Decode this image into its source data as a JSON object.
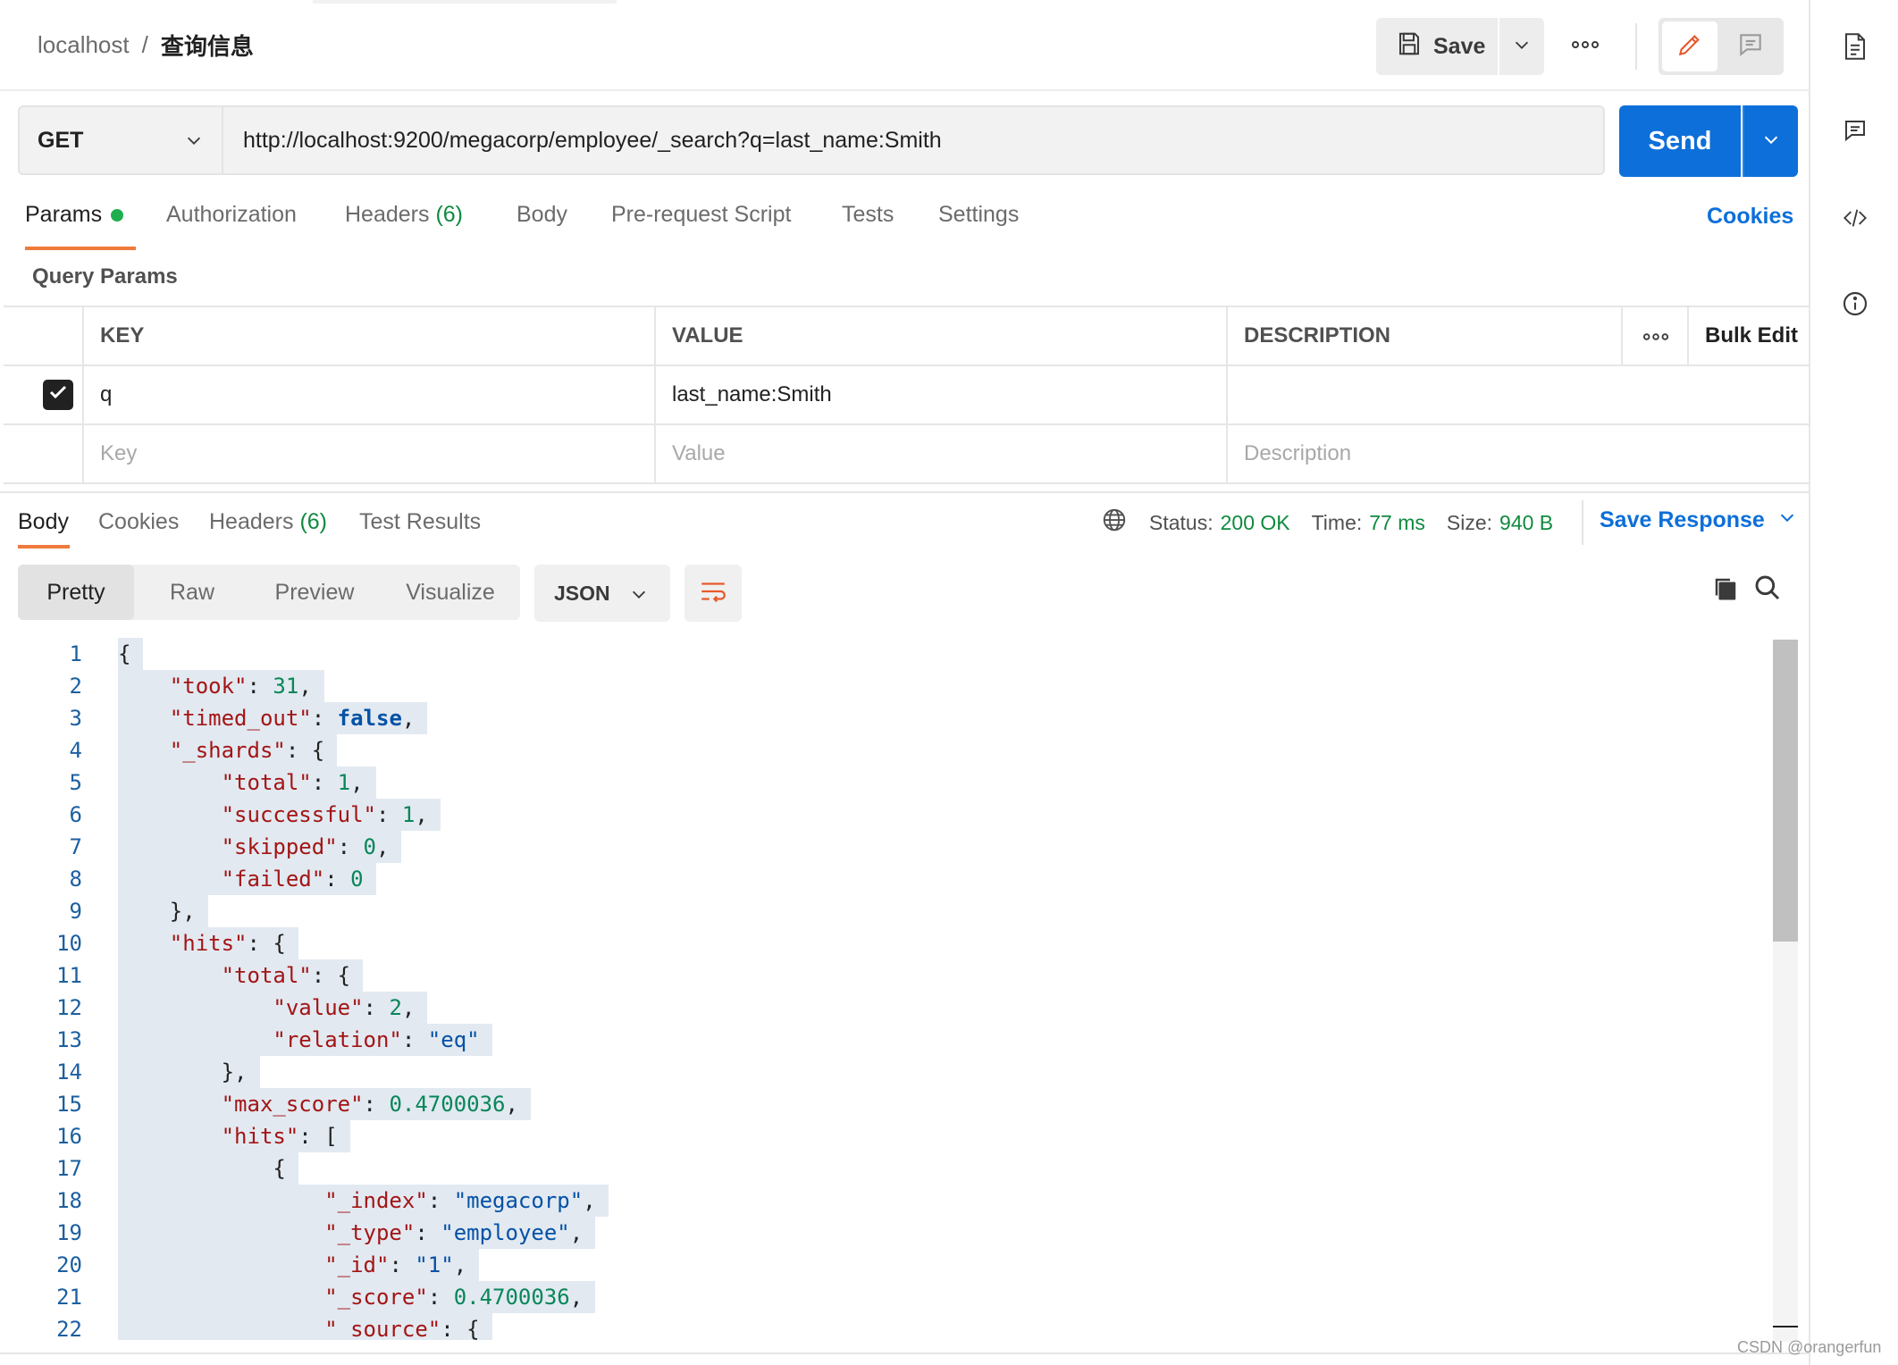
{
  "header": {
    "breadcrumb_host": "localhost",
    "breadcrumb_sep": "/",
    "request_name": "查询信息",
    "save_label": "Save"
  },
  "request": {
    "method": "GET",
    "url": "http://localhost:9200/megacorp/employee/_search?q=last_name:Smith",
    "send_label": "Send"
  },
  "tabs": {
    "params": "Params",
    "authorization": "Authorization",
    "headers": "Headers",
    "headers_count": "(6)",
    "body": "Body",
    "prerequest": "Pre-request Script",
    "tests": "Tests",
    "settings": "Settings",
    "cookies": "Cookies"
  },
  "query_params": {
    "title": "Query Params",
    "columns": {
      "key": "KEY",
      "value": "VALUE",
      "description": "DESCRIPTION",
      "bulk_edit": "Bulk Edit"
    },
    "rows": [
      {
        "checked": true,
        "key": "q",
        "value": "last_name:Smith",
        "description": ""
      }
    ],
    "placeholders": {
      "key": "Key",
      "value": "Value",
      "description": "Description"
    }
  },
  "response": {
    "tabs": {
      "body": "Body",
      "cookies": "Cookies",
      "headers": "Headers",
      "headers_count": "(6)",
      "test_results": "Test Results"
    },
    "status_label": "Status:",
    "status_value": "200 OK",
    "time_label": "Time:",
    "time_value": "77 ms",
    "size_label": "Size:",
    "size_value": "940 B",
    "save_response": "Save Response",
    "views": {
      "pretty": "Pretty",
      "raw": "Raw",
      "preview": "Preview",
      "visualize": "Visualize"
    },
    "format": "JSON",
    "code_lines": [
      "1",
      "2",
      "3",
      "4",
      "5",
      "6",
      "7",
      "8",
      "9",
      "10",
      "11",
      "12",
      "13",
      "14",
      "15",
      "16",
      "17",
      "18",
      "19",
      "20",
      "21",
      "22"
    ],
    "json": {
      "took": "31",
      "timed_out": "false",
      "shards_total": "1",
      "shards_successful": "1",
      "shards_skipped": "0",
      "shards_failed": "0",
      "hits_total_value": "2",
      "hits_total_relation": "\"eq\"",
      "max_score": "0.4700036",
      "hit_index": "\"megacorp\"",
      "hit_type": "\"employee\"",
      "hit_id": "\"1\"",
      "hit_score": "0.4700036"
    }
  },
  "watermark": "CSDN @orangerfun",
  "colors": {
    "accent": "#0d6fd9",
    "tab_underline": "#f07a3c",
    "success": "#0f8a3f"
  }
}
